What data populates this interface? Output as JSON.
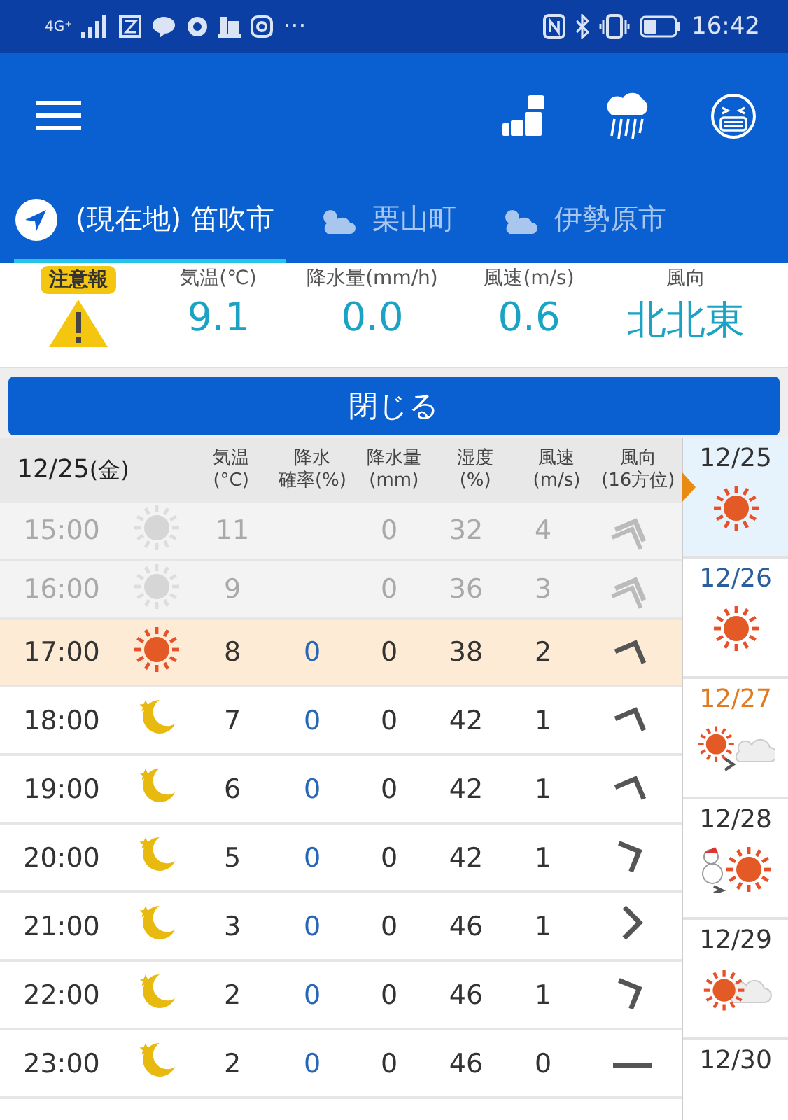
{
  "status_bar": {
    "network": "4G⁺",
    "more": "···",
    "time": "16:42"
  },
  "tabs": [
    {
      "label": "(現在地) 笛吹市",
      "kind": "location",
      "selected": true
    },
    {
      "label": "栗山町",
      "kind": "weather",
      "selected": false
    },
    {
      "label": "伊勢原市",
      "kind": "weather",
      "selected": false
    }
  ],
  "summary": {
    "alert": "注意報",
    "items": [
      {
        "label": "気温(℃)",
        "value": "9.1"
      },
      {
        "label": "降水量(mm/h)",
        "value": "0.0"
      },
      {
        "label": "風速(m/s)",
        "value": "0.6"
      },
      {
        "label": "風向",
        "value": "北北東"
      }
    ]
  },
  "close_button": "閉じる",
  "table": {
    "date": "12/25",
    "weekday": "(金)",
    "columns": [
      {
        "top": "気温",
        "bottom": "(°C)"
      },
      {
        "top": "降水",
        "bottom": "確率(%)"
      },
      {
        "top": "降水量",
        "bottom": "(mm)"
      },
      {
        "top": "湿度",
        "bottom": "(%)"
      },
      {
        "top": "風速",
        "bottom": "(m/s)"
      },
      {
        "top": "風向",
        "bottom": "(16方位)"
      }
    ],
    "rows": [
      {
        "time": "15:00",
        "icon": {
          "kind": "sunny"
        },
        "temp": "11",
        "prob": "",
        "amount": "0",
        "humidity": "32",
        "wind": "4",
        "arrow": {
          "kind": "SSW"
        },
        "kind": "past"
      },
      {
        "time": "16:00",
        "icon": {
          "kind": "sunny"
        },
        "temp": "9",
        "prob": "",
        "amount": "0",
        "humidity": "36",
        "wind": "3",
        "arrow": {
          "kind": "SSW"
        },
        "kind": "past"
      },
      {
        "time": "17:00",
        "icon": {
          "kind": "sunny"
        },
        "temp": "8",
        "prob": "0",
        "amount": "0",
        "humidity": "38",
        "wind": "2",
        "arrow": {
          "kind": "SSW"
        },
        "kind": "current"
      },
      {
        "time": "18:00",
        "icon": {
          "kind": "night"
        },
        "temp": "7",
        "prob": "0",
        "amount": "0",
        "humidity": "42",
        "wind": "1",
        "arrow": {
          "kind": "SSW"
        },
        "kind": "future"
      },
      {
        "time": "19:00",
        "icon": {
          "kind": "night"
        },
        "temp": "6",
        "prob": "0",
        "amount": "0",
        "humidity": "42",
        "wind": "1",
        "arrow": {
          "kind": "SSW"
        },
        "kind": "future"
      },
      {
        "time": "20:00",
        "icon": {
          "kind": "night"
        },
        "temp": "5",
        "prob": "0",
        "amount": "0",
        "humidity": "42",
        "wind": "1",
        "arrow": {
          "kind": "WSW"
        },
        "kind": "future"
      },
      {
        "time": "21:00",
        "icon": {
          "kind": "night"
        },
        "temp": "3",
        "prob": "0",
        "amount": "0",
        "humidity": "46",
        "wind": "1",
        "arrow": {
          "kind": "W"
        },
        "kind": "future"
      },
      {
        "time": "22:00",
        "icon": {
          "kind": "night"
        },
        "temp": "2",
        "prob": "0",
        "amount": "0",
        "humidity": "46",
        "wind": "1",
        "arrow": {
          "kind": "WSW"
        },
        "kind": "future"
      },
      {
        "time": "23:00",
        "icon": {
          "kind": "night"
        },
        "temp": "2",
        "prob": "0",
        "amount": "0",
        "humidity": "46",
        "wind": "0",
        "arrow": {
          "kind": "calm"
        },
        "kind": "future"
      }
    ]
  },
  "days": [
    {
      "date": "12/25",
      "icon": {
        "kind": "sunny"
      },
      "color": "#333333",
      "selected": true
    },
    {
      "date": "12/26",
      "icon": {
        "kind": "sunny"
      },
      "color": "#2a5f9e",
      "selected": false
    },
    {
      "date": "12/27",
      "icon": {
        "kind": "sunny_to_cloudy"
      },
      "color": "#e07b22",
      "selected": false
    },
    {
      "date": "12/28",
      "icon": {
        "kind": "snow_to_sunny"
      },
      "color": "#333333",
      "selected": false
    },
    {
      "date": "12/29",
      "icon": {
        "kind": "sunny_cloudy"
      },
      "color": "#333333",
      "selected": false
    },
    {
      "date": "12/30",
      "color": "#333333",
      "selected": false
    }
  ]
}
